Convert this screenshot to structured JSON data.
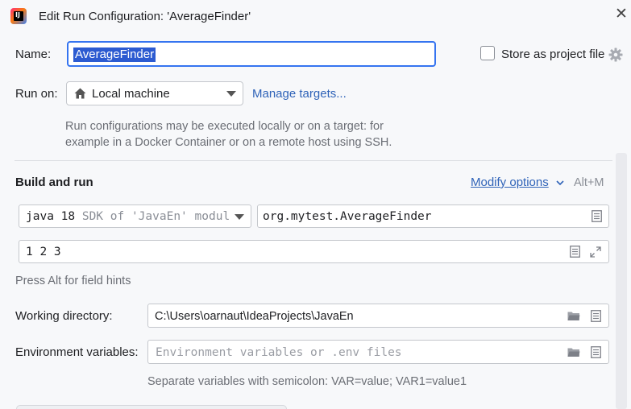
{
  "window": {
    "title": "Edit Run Configuration: 'AverageFinder'",
    "close_glyph": "✕"
  },
  "name": {
    "label": "Name:",
    "value": "AverageFinder"
  },
  "store": {
    "label": "Store as project file",
    "checked": false
  },
  "run_on": {
    "label": "Run on:",
    "value": "Local machine",
    "manage_link": "Manage targets...",
    "help": "Run configurations may be executed locally or on a target: for example in a Docker Container or on a remote host using SSH."
  },
  "build_run": {
    "title": "Build and run",
    "modify_options": "Modify options",
    "shortcut": "Alt+M",
    "jdk_bold": "java 18",
    "jdk_detail": "SDK of 'JavaEn' module",
    "main_class": "org.mytest.AverageFinder",
    "program_args": "1 2 3",
    "hint": "Press Alt for field hints"
  },
  "working_dir": {
    "label": "Working directory:",
    "value": "C:\\Users\\oarnaut\\IdeaProjects\\JavaEn"
  },
  "env_vars": {
    "label": "Environment variables:",
    "placeholder": "Environment variables or .env files",
    "help": "Separate variables with semicolon: VAR=value; VAR1=value1"
  },
  "colors": {
    "accent": "#3574f0",
    "link": "#2f63b8",
    "selection": "#2c5bd1",
    "background": "#f7f8fa"
  }
}
